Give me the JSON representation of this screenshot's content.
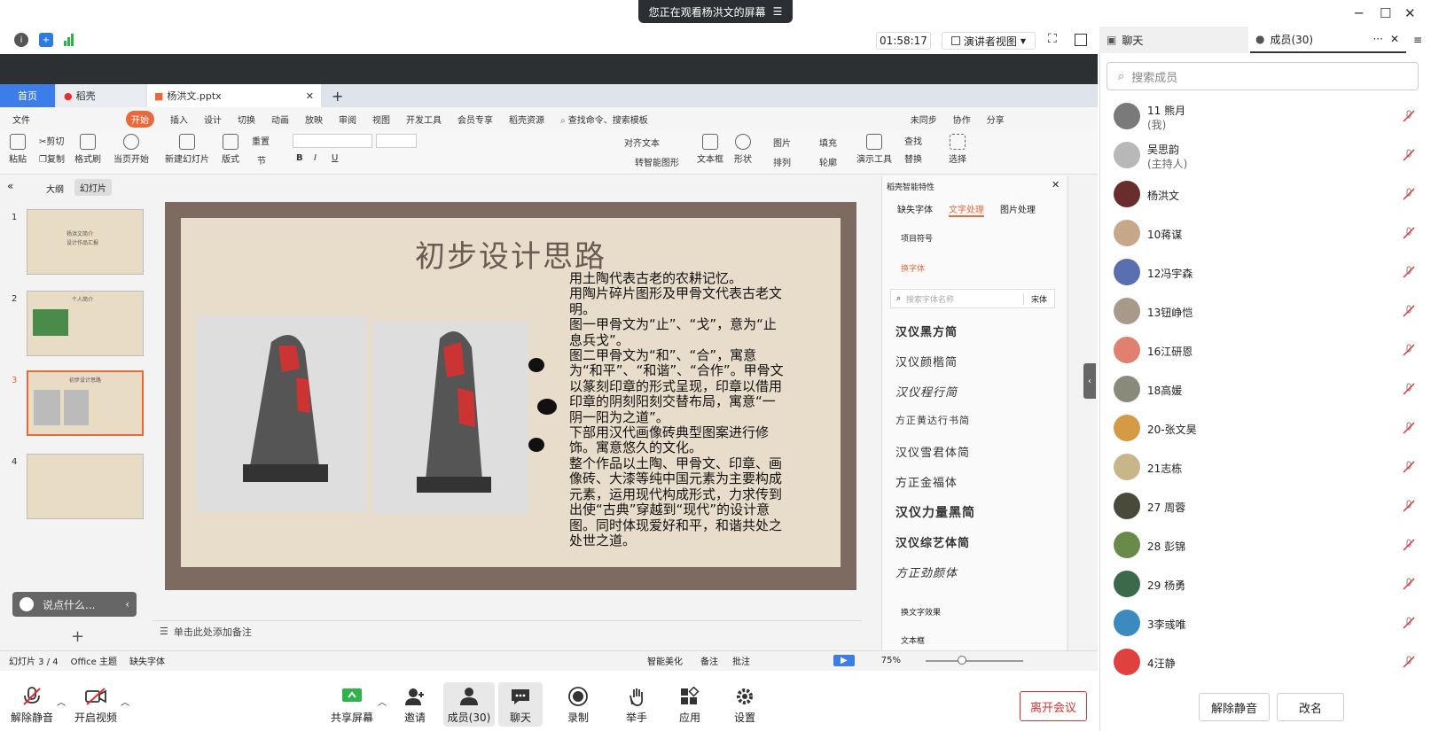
{
  "banner": {
    "text": "您正在观看杨洪文的屏幕"
  },
  "meeting": {
    "timer": "01:58:17",
    "view_mode": "演讲者视图"
  },
  "wps": {
    "tabs": {
      "home": "首页",
      "daoke": "稻壳",
      "file": "杨洪文.pptx"
    },
    "menu": [
      "文件",
      "开始",
      "插入",
      "设计",
      "切换",
      "动画",
      "放映",
      "审阅",
      "视图",
      "开发工具",
      "会员专享",
      "稻壳资源"
    ],
    "search_hint": "查找命令、搜索模板",
    "right_menu": {
      "sync": "未同步",
      "collab": "协作",
      "share": "分享"
    },
    "ribbon": {
      "paste": "粘贴",
      "cut": "剪切",
      "copy": "复制",
      "format_painter": "格式刷",
      "from_current": "当页开始",
      "new_slide": "新建幻灯片",
      "layout": "版式",
      "section": "节",
      "reset": "重置",
      "align_text": "对齐文本",
      "smart_graphic": "转智能图形",
      "textbox": "文本框",
      "shape": "形状",
      "picture": "图片",
      "fill": "填充",
      "arrange": "排列",
      "outline": "轮廓",
      "present_tools": "演示工具",
      "find": "查找",
      "replace": "替换",
      "select": "选择"
    },
    "pane_tabs": {
      "outline": "大纲",
      "slides": "幻灯片"
    },
    "thumbs": [
      {
        "num": "1",
        "title": "杨洪文简介",
        "sub": "设计作品汇报"
      },
      {
        "num": "2",
        "title": "个人简介"
      },
      {
        "num": "3",
        "title": "初步设计思路"
      },
      {
        "num": "4",
        "title": ""
      }
    ],
    "slide": {
      "title": "初步设计思路",
      "body": "用土陶代表古老的农耕记忆。\n用陶片碎片图形及甲骨文代表古老文明。\n图一甲骨文为“止”、“戈”，意为“止息兵戈”。\n图二甲骨文为“和”、“合”，寓意为“和平”、“和谐”、“合作”。甲骨文以篆刻印章的形式呈现，印章以借用印章的阴刻阳刻交替布局，寓意“一阴一阳为之道”。\n下部用汉代画像砖典型图案进行修饰。寓意悠久的文化。\n整个作品以土陶、甲骨文、印章、画像砖、大漆等纯中国元素为主要构成元素，运用现代构成形式，力求传到出使“古典”穿越到“现代”的设计意图。同时体现爱好和平，和谐共处之处世之道。"
    },
    "notes_placeholder": "单击此处添加备注",
    "chat_hint": "说点什么...",
    "right_panel": {
      "title": "稻壳智能特性",
      "tabs": [
        "缺失字体",
        "文字处理",
        "图片处理"
      ],
      "item_bullet": "项目符号",
      "item_font": "换字体",
      "font_search_placeholder": "搜索字体名称",
      "font_current": "宋体",
      "fonts": [
        "汉仪黑方简",
        "汉仪颜楷简",
        "汉仪程行简",
        "方正黄达行书简",
        "汉仪雪君体简",
        "方正金福体",
        "汉仪力量黑简",
        "汉仪综艺体简",
        "方正劲颜体"
      ],
      "item_effect": "换文字效果",
      "item_textbox": "文本框"
    },
    "status": {
      "slide_pos": "幻灯片 3 / 4",
      "theme": "Office 主题",
      "missing_font": "缺失字体",
      "beautify": "智能美化",
      "notes": "备注",
      "comment": "批注",
      "zoom": "75%"
    }
  },
  "toolbar": {
    "unmute": "解除静音",
    "start_video": "开启视频",
    "share_screen": "共享屏幕",
    "invite": "邀请",
    "members": "成员(30)",
    "chat": "聊天",
    "record": "录制",
    "raise_hand": "举手",
    "apps": "应用",
    "settings": "设置",
    "leave": "离开会议"
  },
  "side": {
    "tab_chat": "聊天",
    "tab_members": "成员(30)",
    "search_placeholder": "搜索成员",
    "members": [
      {
        "name": "11 熊月",
        "role": "(我)",
        "color": "#7a7a7a"
      },
      {
        "name": "吴思韵",
        "role": "(主持人)",
        "color": "#b8b8b8"
      },
      {
        "name": "杨洪文",
        "role": "",
        "color": "#6a2d2d"
      },
      {
        "name": "10蒋谋",
        "role": "",
        "color": "#c7a78a"
      },
      {
        "name": "12冯宇森",
        "role": "",
        "color": "#5a6fb0"
      },
      {
        "name": "13钮峥恺",
        "role": "",
        "color": "#a89a88"
      },
      {
        "name": "16江研恩",
        "role": "",
        "color": "#e08070"
      },
      {
        "name": "18高媛",
        "role": "",
        "color": "#8a8a7a"
      },
      {
        "name": "20-张文昊",
        "role": "",
        "color": "#d59a45"
      },
      {
        "name": "21志栋",
        "role": "",
        "color": "#c9b58a"
      },
      {
        "name": "27 周蓉",
        "role": "",
        "color": "#4a4a3a"
      },
      {
        "name": "28 彭锦",
        "role": "",
        "color": "#6a8a4a"
      },
      {
        "name": "29 杨勇",
        "role": "",
        "color": "#3a6a4a"
      },
      {
        "name": "3李彧唯",
        "role": "",
        "color": "#3a8ac0"
      },
      {
        "name": "4汪静",
        "role": "",
        "color": "#e04040"
      }
    ],
    "btn_unmute_all": "解除静音",
    "btn_rename": "改名"
  }
}
